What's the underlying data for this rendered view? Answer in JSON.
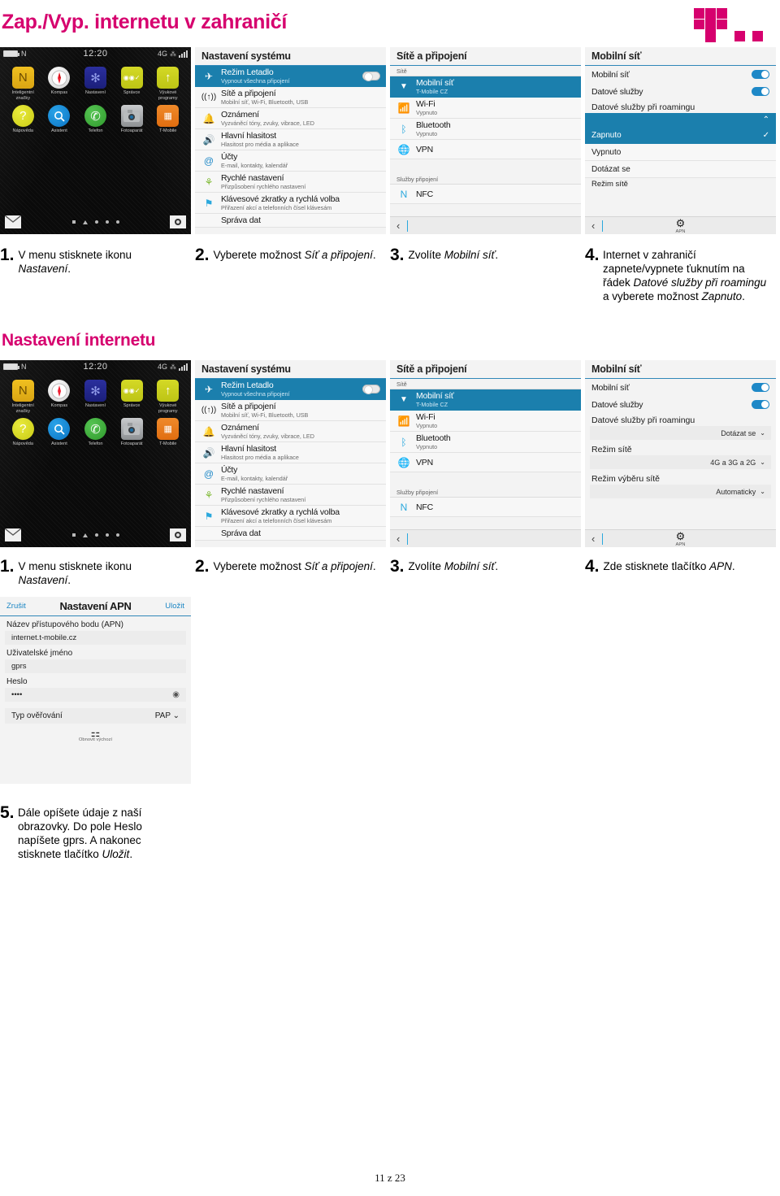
{
  "header": {
    "title": "Zap./Vyp. internetu v zahraničí",
    "logo_name": "t-mobile-logo",
    "brand_color": "#d6006e"
  },
  "section_title": "Nastavení internetu",
  "footer": {
    "page": "11 z 23"
  },
  "phone_home": {
    "status": {
      "nfc": "N",
      "time": "12:20",
      "network": "4G"
    },
    "apps": [
      {
        "label": "Inteligentní značky",
        "icon": "nfc-tag-icon",
        "glyph": "N"
      },
      {
        "label": "Kompas",
        "icon": "compass-icon",
        "glyph": ""
      },
      {
        "label": "Nastavení",
        "icon": "settings-gear-icon",
        "glyph": "✻"
      },
      {
        "label": "Správce",
        "icon": "manager-icon",
        "glyph": "◉◉✓"
      },
      {
        "label": "Výukové programy",
        "icon": "tutorial-arrow-icon",
        "glyph": "↑"
      },
      {
        "label": "Nápověda",
        "icon": "help-question-icon",
        "glyph": "?"
      },
      {
        "label": "Asistent",
        "icon": "assistant-search-icon",
        "glyph": "🔍"
      },
      {
        "label": "Telefon",
        "icon": "phone-handset-icon",
        "glyph": "✆"
      },
      {
        "label": "Fotoaparát",
        "icon": "camera-icon",
        "glyph": "◉"
      },
      {
        "label": "T-Mobile",
        "icon": "tmobile-app-icon",
        "glyph": "▦"
      }
    ],
    "dock": {
      "left_icon": "mail-icon",
      "right_icon": "camera-icon"
    }
  },
  "system_settings": {
    "title": "Nastavení systému",
    "rows": [
      {
        "title": "Režim Letadlo",
        "sub": "Vypnout všechna připojení",
        "icon": "airplane-icon",
        "selected": true,
        "toggle": "off"
      },
      {
        "title": "Sítě a připojení",
        "sub": "Mobilní síť, Wi-Fi, Bluetooth, USB",
        "icon": "network-icon",
        "selected": false
      },
      {
        "title": "Oznámení",
        "sub": "Vyzváněcí tóny, zvuky, vibrace, LED",
        "icon": "bell-icon",
        "selected": false
      },
      {
        "title": "Hlavní hlasitost",
        "sub": "Hlasitost pro média a aplikace",
        "icon": "speaker-icon",
        "selected": false
      },
      {
        "title": "Účty",
        "sub": "E-mail, kontakty, kalendář",
        "icon": "accounts-icon",
        "selected": false
      },
      {
        "title": "Rychlé nastavení",
        "sub": "Přizpůsobení rychlého nastavení",
        "icon": "quick-settings-icon",
        "selected": false
      },
      {
        "title": "Klávesové zkratky a rychlá volba",
        "sub": "Přiřazení akcí a telefonních čísel klávesám",
        "icon": "shortcut-icon",
        "selected": false
      },
      {
        "title": "Správa dat",
        "sub": "",
        "icon": "data-icon",
        "selected": false
      }
    ]
  },
  "networks": {
    "title": "Sítě a připojení",
    "section1": "Sítě",
    "section2": "Služby připojení",
    "rows": [
      {
        "title": "Mobilní síť",
        "sub": "T-Mobile CZ",
        "icon": "cell-tower-icon",
        "selected": true
      },
      {
        "title": "Wi-Fi",
        "sub": "Vypnuto",
        "icon": "wifi-icon",
        "selected": false
      },
      {
        "title": "Bluetooth",
        "sub": "Vypnuto",
        "icon": "bluetooth-icon",
        "selected": false
      },
      {
        "title": "VPN",
        "sub": "",
        "icon": "vpn-globe-icon",
        "selected": false
      },
      {
        "title": "NFC",
        "sub": "",
        "icon": "nfc-icon",
        "selected": false
      }
    ]
  },
  "mobile_network_roaming": {
    "title": "Mobilní síť",
    "row_mobile": {
      "label": "Mobilní síť",
      "toggle": "on"
    },
    "row_data": {
      "label": "Datové služby",
      "toggle": "on"
    },
    "roaming_caption": "Datové služby při roamingu",
    "dropdown_options": [
      {
        "label": "Zapnuto",
        "checked": true
      },
      {
        "label": "Vypnuto",
        "checked": false
      },
      {
        "label": "Dotázat se",
        "checked": false
      }
    ],
    "trailing_caption": "Režim sítě",
    "back_icon": "back-chevron-icon",
    "apn_button": {
      "label": "APN",
      "icon": "gear-icon"
    }
  },
  "mobile_network_apn": {
    "title": "Mobilní síť",
    "row_mobile": {
      "label": "Mobilní síť",
      "toggle": "on"
    },
    "row_data": {
      "label": "Datové služby",
      "toggle": "on"
    },
    "fields": [
      {
        "caption": "Datové služby při roamingu",
        "value": "Dotázat se"
      },
      {
        "caption": "Režim sítě",
        "value": "4G a 3G a 2G"
      },
      {
        "caption": "Režim výběru sítě",
        "value": "Automaticky"
      }
    ],
    "back_icon": "back-chevron-icon",
    "apn_button": {
      "label": "APN",
      "icon": "gear-icon"
    }
  },
  "apn_settings": {
    "cancel": "Zrušit",
    "title": "Nastavení APN",
    "save": "Uložit",
    "fields": [
      {
        "label": "Název přístupového bodu (APN)",
        "value": "internet.t-mobile.cz"
      },
      {
        "label": "Uživatelské jméno",
        "value": "gprs"
      },
      {
        "label": "Heslo",
        "value": "••••"
      }
    ],
    "auth": {
      "label": "Typ ověřování",
      "value": "PAP"
    },
    "reset": {
      "label": "Obnovit výchozí",
      "icon": "sliders-icon"
    }
  },
  "steps_row1": [
    {
      "num": "1.",
      "pre": "V menu stisknete ikonu ",
      "em": "Nastavení",
      "post": "."
    },
    {
      "num": "2.",
      "pre": "Vyberete možnost ",
      "em": "Síť a připojení",
      "post": "."
    },
    {
      "num": "3.",
      "pre": "Zvolíte ",
      "em": "Mobilní síť",
      "post": "."
    },
    {
      "num": "4.",
      "pre": "Internet v zahraničí zapnete/vypnete ťuknutím na řádek ",
      "em": "Datové služby při roamingu",
      "post": " a vyberete možnost ",
      "em2": "Zapnuto",
      "post2": "."
    }
  ],
  "steps_row2": [
    {
      "num": "1.",
      "pre": "V menu stisknete ikonu ",
      "em": "Nastavení",
      "post": "."
    },
    {
      "num": "2.",
      "pre": "Vyberete možnost ",
      "em": "Síť a připojení",
      "post": "."
    },
    {
      "num": "3.",
      "pre": "Zvolíte ",
      "em": "Mobilní síť",
      "post": "."
    },
    {
      "num": "4.",
      "pre": "Zde stisknete tlačítko ",
      "em": "APN",
      "post": "."
    }
  ],
  "step5": {
    "num": "5.",
    "pre": "Dále opíšete údaje z naší obrazovky. Do pole Heslo napíšete gprs. A nakonec stisknete tlačítko ",
    "em": "Uložit",
    "post": "."
  }
}
